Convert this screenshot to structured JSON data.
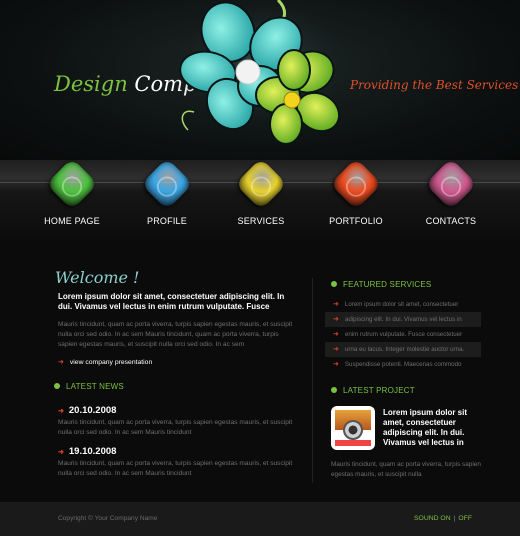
{
  "header": {
    "logo_part1": "Design",
    "logo_part2": "Company",
    "tagline": "Providing the Best Services"
  },
  "nav": [
    {
      "label": "HOME PAGE",
      "color": "#4cc23e"
    },
    {
      "label": "PROFILE",
      "color": "#3aa6e6"
    },
    {
      "label": "SERVICES",
      "color": "#e8d22c"
    },
    {
      "label": "PORTFOLIO",
      "color": "#ee4a1e"
    },
    {
      "label": "CONTACTS",
      "color": "#d0588f"
    }
  ],
  "welcome": {
    "title": "Welcome !",
    "bold": "Lorem ipsum dolor sit amet, consectetuer adipiscing elit. In dui. Vivamus vel lectus in enim rutrum vulputate. Fusce",
    "text": "Mauris tincidunt, quam ac porta viverra, turpis sapien egestas mauris, et suscipit nulla orci sed odio. In ac sem Mauris tincidunt, quam ac porta viverra, turpis sapien egestas mauris, et suscipit nulla orci sed odio. In ac sem",
    "more": "view company presentation"
  },
  "news": {
    "heading": "LATEST NEWS",
    "items": [
      {
        "date": "20.10.2008",
        "text": "Mauris tincidunt, quam ac porta viverra, turpis sapien egestas mauris, et suscipit nulla orci sed odio. In ac sem Mauris tincidunt"
      },
      {
        "date": "19.10.2008",
        "text": "Mauris tincidunt, quam ac porta viverra, turpis sapien egestas mauris, et suscipit nulla orci sed odio. In ac sem Mauris tincidunt"
      }
    ]
  },
  "services": {
    "heading": "FEATURED SERVICES",
    "items": [
      "Lorem ipsum dolor sit amet, consectetuer",
      "adipiscing elit. In dui. Vivamus vel lectus in",
      "enim rutrum vulputate. Fusce consectetuer",
      "urna eu lacus. Integer molestie auctor urna.",
      "Suspendisse potenti. Maecenas commodo"
    ]
  },
  "project": {
    "heading": "LATEST PROJECT",
    "title": "Lorem ipsum dolor sit amet, consectetuer adipiscing elit. In dui. Vivamus vel lectus in",
    "text": "Mauris tincidunt, quam ac porta viverra, turpis sapien egestas mauris, et suscipit nulla"
  },
  "footer": {
    "copyright": "Copyright © Your Company Name",
    "sound_on": "SOUND ON",
    "sound_off": "OFF",
    "separator": "|"
  },
  "arrow_glyph": "➜"
}
